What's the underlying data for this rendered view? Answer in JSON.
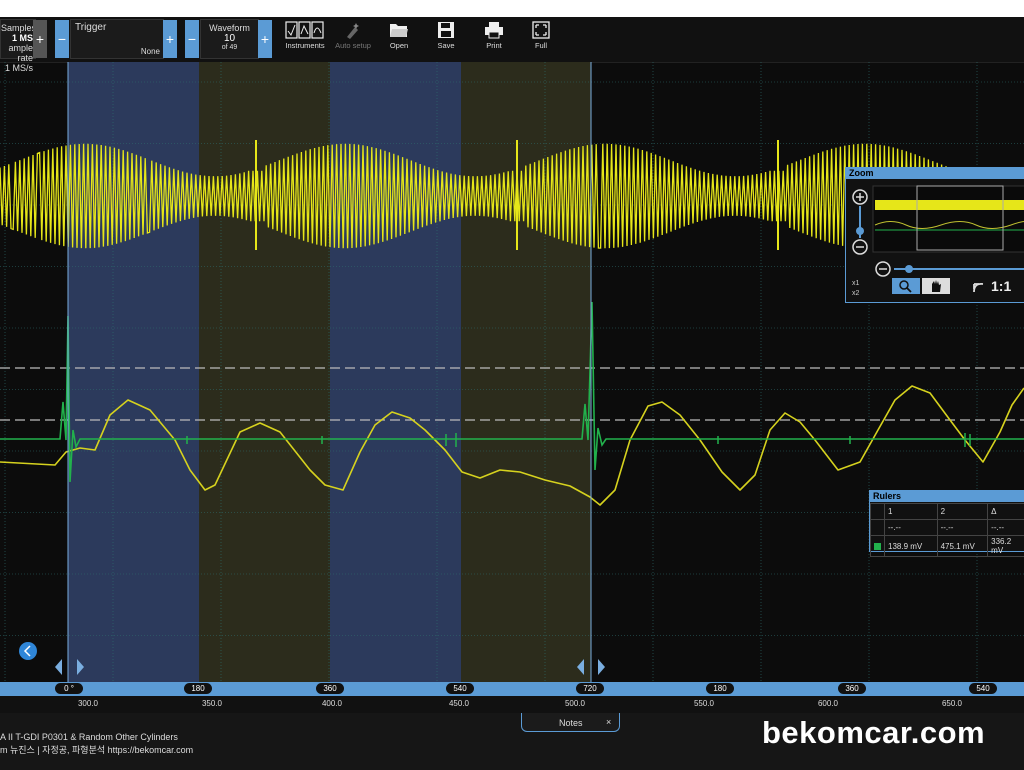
{
  "toolbar": {
    "samples_label": "Samples",
    "samples_value": "1 MS",
    "sample_rate_label": "ample rate",
    "sample_rate_value": "1 MS/s",
    "trigger_label": "Trigger",
    "trigger_value": "None",
    "waveform_label": "Waveform",
    "waveform_value": "10",
    "waveform_total": "of 49",
    "instruments": "Instruments",
    "auto_setup": "Auto setup",
    "open": "Open",
    "save": "Save",
    "print": "Print",
    "full": "Full"
  },
  "zoom": {
    "title": "Zoom",
    "x1": "x1",
    "x2": "x2",
    "ratio": "1:1"
  },
  "rulers": {
    "title": "Rulers",
    "headers": [
      "1",
      "2",
      "Δ"
    ],
    "row1": [
      "--.--",
      "--.--",
      "--.--"
    ],
    "row2": [
      "138.9 mV",
      "475.1 mV",
      "336.2 mV"
    ]
  },
  "axis": {
    "degree_labels": [
      "0 °",
      "180",
      "360",
      "540",
      "720",
      "180",
      "360",
      "540"
    ],
    "time_labels": [
      "300.0",
      "350.0",
      "400.0",
      "450.0",
      "500.0",
      "550.0",
      "600.0",
      "650.0"
    ]
  },
  "notes_tab": "Notes",
  "bottom_text": {
    "line1": "A II T-GDI P0301 & Random Other Cylinders",
    "line2": "m 뉴진스 | 자정공, 파형분석 https://bekomcar.com"
  },
  "watermark": "bekomcar.com",
  "colors": {
    "accent": "#5b9bd5",
    "trace_yellow": "#e6e619",
    "trace_green": "#22b14c",
    "cycle_blue": "#2c3a5c",
    "cycle_olive": "#2c2c1c"
  }
}
